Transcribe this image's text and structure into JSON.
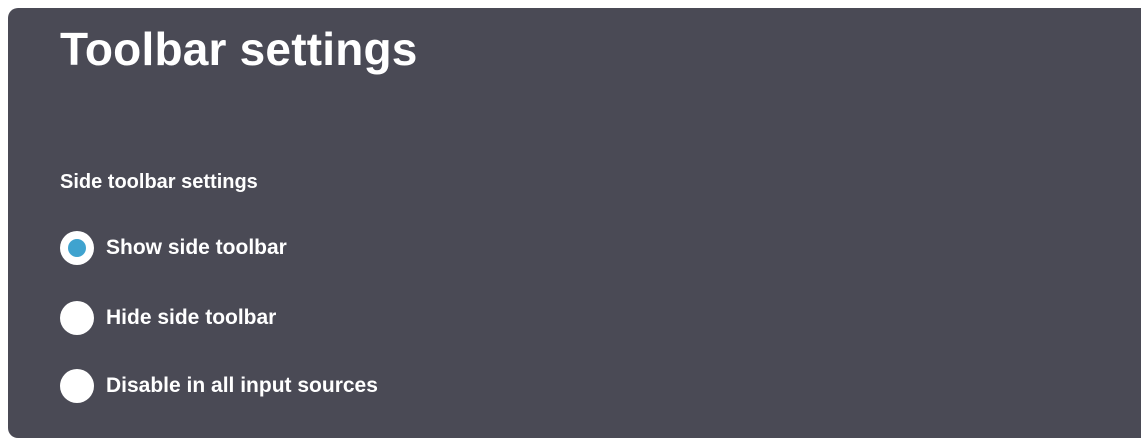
{
  "page": {
    "title": "Toolbar settings"
  },
  "section": {
    "label": "Side toolbar settings"
  },
  "options": [
    {
      "label": "Show side toolbar",
      "selected": true
    },
    {
      "label": "Hide side toolbar",
      "selected": false
    },
    {
      "label": "Disable in all input sources",
      "selected": false
    }
  ],
  "colors": {
    "panel_background": "#4a4a55",
    "text": "#ffffff",
    "radio_accent": "#3fa3cf"
  }
}
